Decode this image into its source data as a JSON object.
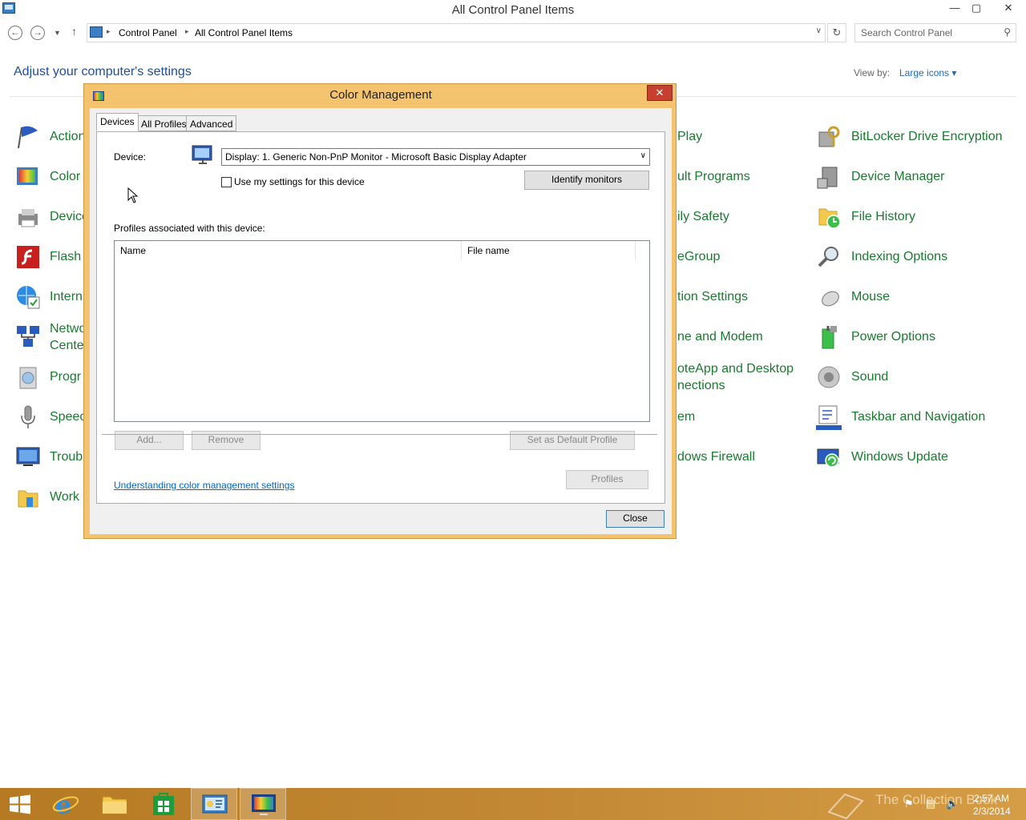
{
  "window": {
    "title": "All Control Panel Items",
    "min": "—",
    "max": "▢",
    "close": "✕"
  },
  "address": {
    "crumbs": [
      "Control Panel",
      "All Control Panel Items"
    ],
    "search_placeholder": "Search Control Panel"
  },
  "content": {
    "heading": "Adjust your computer's settings",
    "view_by_label": "View by:",
    "view_by_value": "Large icons ▾",
    "left_items": [
      "Action",
      "Color",
      "Device",
      "Flash",
      "Intern",
      "Netwo",
      "Cente",
      "Progr",
      "Speec",
      "Troub",
      "Work"
    ],
    "middle_items": [
      "Play",
      "ult Programs",
      "ily Safety",
      "eGroup",
      "tion Settings",
      "ne and Modem",
      "oteApp and Desktop",
      "nections",
      "em",
      "dows Firewall"
    ],
    "right_items": [
      "BitLocker Drive Encryption",
      "Device Manager",
      "File History",
      "Indexing Options",
      "Mouse",
      "Power Options",
      "Sound",
      "Taskbar and Navigation",
      "Windows Update"
    ]
  },
  "dialog": {
    "title": "Color Management",
    "close_glyph": "✕",
    "tabs": [
      "Devices",
      "All Profiles",
      "Advanced"
    ],
    "device_label": "Device:",
    "device_value": "Display: 1. Generic Non-PnP Monitor - Microsoft Basic Display Adapter",
    "use_settings_label": "Use my settings for this device",
    "identify_button": "Identify monitors",
    "profiles_label": "Profiles associated with this device:",
    "columns": [
      "Name",
      "File name"
    ],
    "add_button": "Add...",
    "remove_button": "Remove",
    "set_default_button": "Set as Default Profile",
    "understanding_link": "Understanding color management settings",
    "profiles_button": "Profiles",
    "close_button": "Close"
  },
  "taskbar": {
    "watermark": "The Collection Book",
    "time": "2:57 AM",
    "date": "2/3/2014"
  },
  "colors": {
    "accent_orange": "#f4c36e",
    "link_green": "#1a7a2f",
    "link_blue": "#0066cc",
    "taskbar": "#c48935"
  }
}
